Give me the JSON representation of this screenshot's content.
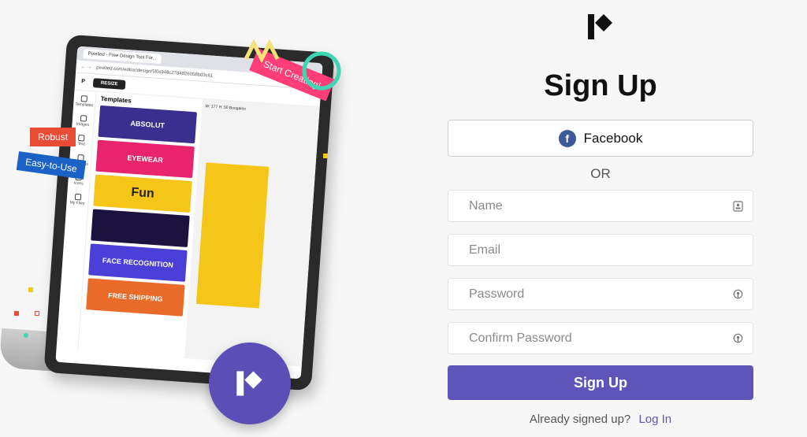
{
  "brand": {
    "logo": "pixelied-logo"
  },
  "form": {
    "title": "Sign Up",
    "facebook_label": "Facebook",
    "facebook_icon": "facebook-icon",
    "or_label": "OR",
    "name_placeholder": "Name",
    "email_placeholder": "Email",
    "password_placeholder": "Password",
    "confirm_placeholder": "Confirm Password",
    "submit_label": "Sign Up",
    "already_text": "Already signed up?",
    "login_link": "Log In"
  },
  "illustration": {
    "tag_robust": "Robust",
    "tag_easy": "Easy-to-Use",
    "tag_start": "Start Creating!",
    "browser_tab": "Pixelied - Free Design Tool For...",
    "url": "pixelied.com/editor/design/5f0c948c27d4826058bd3c61",
    "resize_label": "RESIZE",
    "templates_title": "Templates",
    "tools": [
      "Templates",
      "Images",
      "Text",
      "Elements",
      "Icons",
      "My Files"
    ],
    "tpl_absolut": "ABSOLUT",
    "tpl_eyewear": "EYEWEAR",
    "tpl_fun": "Fun",
    "tpl_face": "FACE RECOGNITION",
    "tpl_shipping": "FREE SHIPPING",
    "canvas_size_w": "W: 177",
    "canvas_size_h": "H: 50",
    "canvas_font": "Boogaloo"
  },
  "colors": {
    "accent": "#5f54b8",
    "facebook": "#3b5998",
    "tag_red": "#e94b35",
    "tag_blue": "#1a62c5",
    "tag_pink": "#ff3d77"
  }
}
